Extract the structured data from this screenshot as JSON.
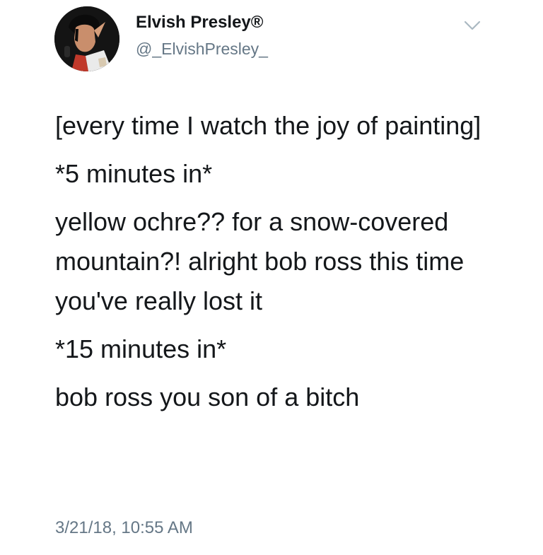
{
  "user": {
    "display_name": "Elvish Presley®",
    "handle": "@_ElvishPresley_"
  },
  "tweet": {
    "paragraphs": [
      "[every time I watch the joy of painting]",
      "*5 minutes in*",
      "yellow ochre?? for a snow-covered mountain?! alright bob ross this time you've really lost it",
      "*15 minutes in*",
      "bob ross you son of a bitch"
    ],
    "timestamp": "3/21/18, 10:55 AM"
  },
  "icons": {
    "avatar": "avatar",
    "menu": "chevron-down-icon"
  },
  "colors": {
    "text_primary": "#14171a",
    "text_secondary": "#657786",
    "chevron": "#aab8c2"
  }
}
